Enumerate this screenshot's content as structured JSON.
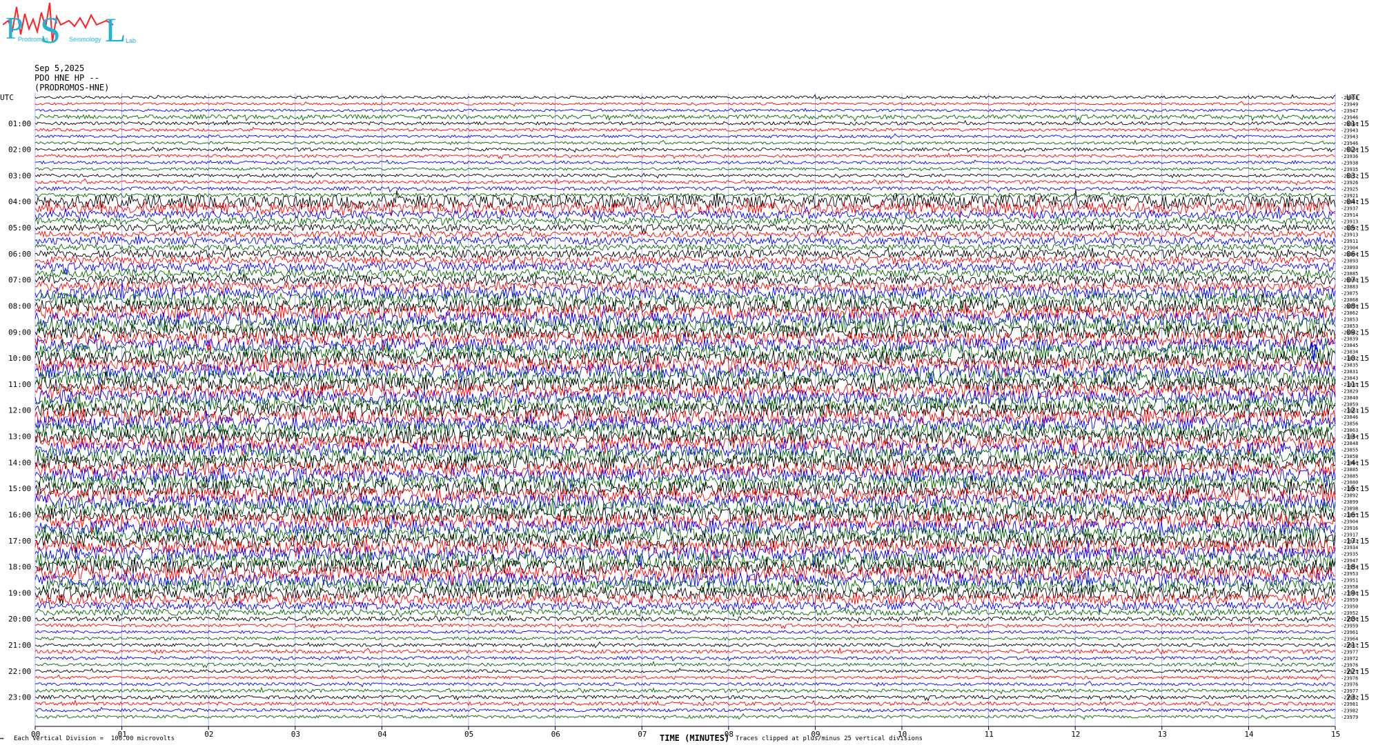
{
  "logo": {
    "letters": [
      "P",
      "S",
      "L"
    ],
    "subtitle_fragments": [
      "Prodromos",
      "Seismology",
      "Lab"
    ],
    "text_color": "#1fb3d8",
    "wave_color": "#ff2020"
  },
  "header": {
    "date": "Sep 5,2025",
    "channel": "PDO HNE HP --",
    "station": "(PRODROMOS-HNE)"
  },
  "axes": {
    "left_unit_label": "UTC",
    "right_unit_label": "UTC",
    "left_hour_labels": [
      "01:00",
      "02:00",
      "03:00",
      "04:00",
      "05:00",
      "06:00",
      "07:00",
      "08:00",
      "09:00",
      "10:00",
      "11:00",
      "12:00",
      "13:00",
      "14:00",
      "15:00",
      "16:00",
      "17:00",
      "18:00",
      "19:00",
      "20:00",
      "21:00",
      "22:00",
      "23:00"
    ],
    "right_hour_labels": [
      "01:15",
      "02:15",
      "03:15",
      "04:15",
      "05:15",
      "06:15",
      "07:15",
      "08:15",
      "09:15",
      "10:15",
      "11:15",
      "12:15",
      "13:15",
      "14:15",
      "15:15",
      "16:15",
      "17:15",
      "18:15",
      "19:15",
      "20:15",
      "21:15",
      "22:15",
      "23:15"
    ],
    "x_tick_labels": [
      "00",
      "01",
      "02",
      "03",
      "04",
      "05",
      "06",
      "07",
      "08",
      "09",
      "10",
      "11",
      "12",
      "13",
      "14",
      "15"
    ],
    "x_title": "TIME (MINUTES)"
  },
  "footer": {
    "vertical_division": "Each Vertical Division =  100.00 microvolts",
    "clip_note": "Traces clipped at plus/minus 25 vertical divisions"
  },
  "chart_data": {
    "type": "line",
    "title": "",
    "xlabel": "TIME (MINUTES)",
    "ylabel": "UTC",
    "xlim": [
      0,
      15
    ],
    "minutes_per_line": 15,
    "line_count": 96,
    "series_colors": [
      "#000000",
      "#ff0000",
      "#0000ff",
      "#006400"
    ],
    "grid": true,
    "baseline_values": [
      -23953,
      -23949,
      -23947,
      -23946,
      -23946,
      -23943,
      -23943,
      -23946,
      -23936,
      -23936,
      -23938,
      -23935,
      -23932,
      -23926,
      -23925,
      -23921,
      -23941,
      -23937,
      -23914,
      -23913,
      -23907,
      -23913,
      -23911,
      -23904,
      -23904,
      -23893,
      -23893,
      -23885,
      -23880,
      -23883,
      -23875,
      -23868,
      -23876,
      -23862,
      -23853,
      -23853,
      -23862,
      -23839,
      -23845,
      -23834,
      -23832,
      -23835,
      -23831,
      -23843,
      -23835,
      -23829,
      -23840,
      -23859,
      -23853,
      -23846,
      -23856,
      -23863,
      -23864,
      -23848,
      -23855,
      -23858,
      -23866,
      -23885,
      -23885,
      -23880,
      -23887,
      -23892,
      -23899,
      -23898,
      -23895,
      -23904,
      -23916,
      -23917,
      -23933,
      -23934,
      -23935,
      -23947,
      -23934,
      -23953,
      -23951,
      -23958,
      -23956,
      -23959,
      -23950,
      -23952,
      -23956,
      -23959,
      -23961,
      -23964,
      -23967,
      -23977,
      -23972,
      -23976,
      -23975,
      -23976,
      -23976,
      -23977,
      -23982,
      -23981,
      -23982,
      -23979
    ],
    "activity_level": [
      0.08,
      0.06,
      0.05,
      0.2,
      0.12,
      0.1,
      0.08,
      0.07,
      0.1,
      0.1,
      0.09,
      0.08,
      0.1,
      0.12,
      0.15,
      0.15,
      0.9,
      0.8,
      0.5,
      0.4,
      0.4,
      0.35,
      0.5,
      0.35,
      0.5,
      0.5,
      0.55,
      0.5,
      0.6,
      0.6,
      0.85,
      0.9,
      0.9,
      0.95,
      1,
      1,
      0.95,
      0.95,
      0.9,
      1,
      1,
      0.95,
      1,
      1,
      1,
      0.9,
      1,
      1,
      1,
      1,
      1,
      1,
      1,
      1,
      1,
      1,
      1,
      1,
      1,
      1,
      1,
      1,
      1,
      1,
      1,
      1,
      1,
      1,
      1,
      1,
      1,
      1,
      1,
      1,
      0.95,
      0.9,
      0.85,
      0.7,
      0.5,
      0.35,
      0.2,
      0.12,
      0.1,
      0.1,
      0.12,
      0.15,
      0.12,
      0.12,
      0.1,
      0.1,
      0.1,
      0.12,
      0.15,
      0.15,
      0.12,
      0.1
    ],
    "events": [
      {
        "line": 39,
        "minute": 14.75,
        "note": "blue spike near 10:15"
      }
    ]
  }
}
